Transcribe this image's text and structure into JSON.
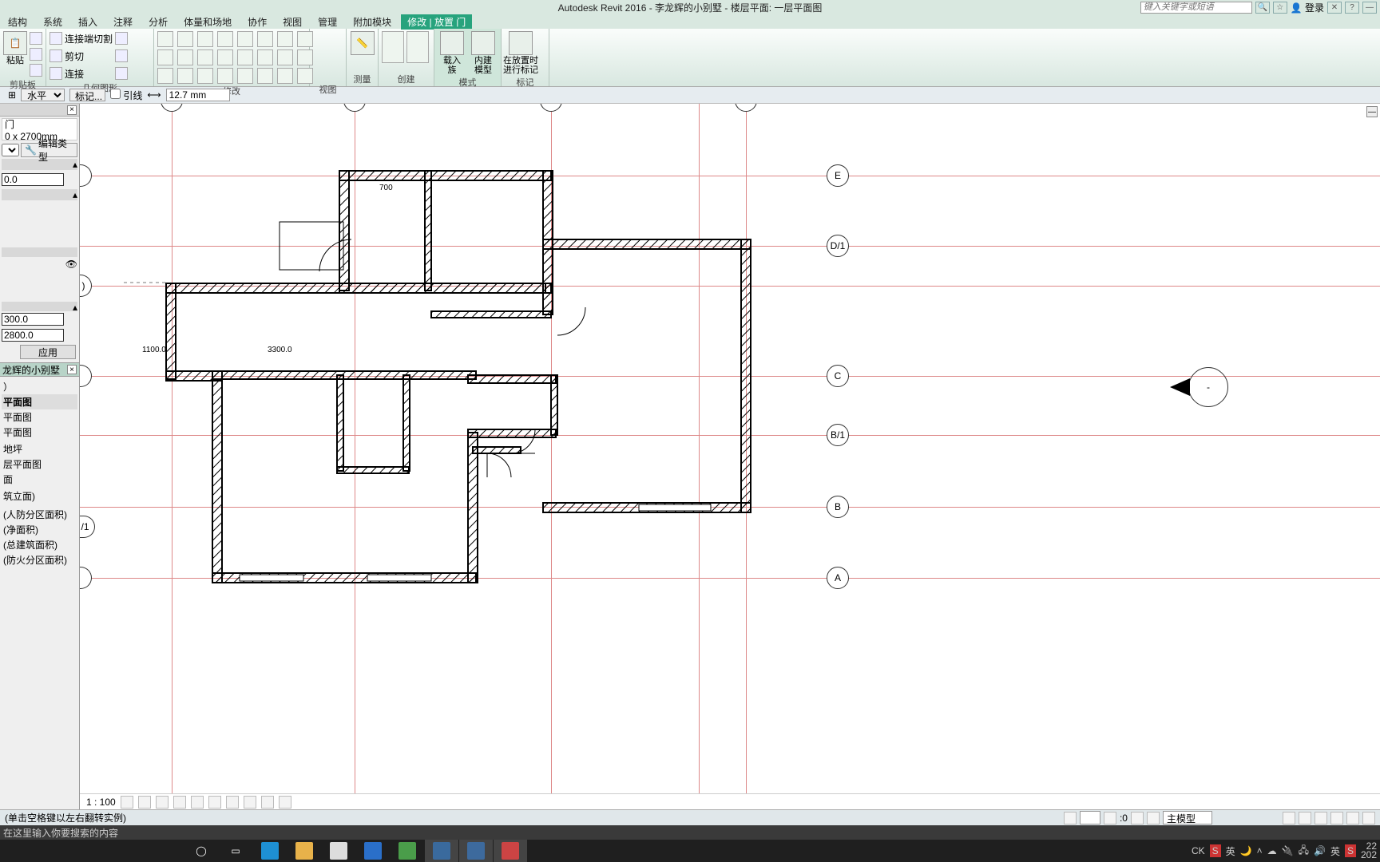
{
  "title": "Autodesk Revit 2016 -     李龙辉的小别墅 - 楼层平面: 一层平面图",
  "search_placeholder": "键入关键字或短语",
  "login_label": "登录",
  "menu": [
    "结构",
    "系统",
    "插入",
    "注释",
    "分析",
    "体量和场地",
    "协作",
    "视图",
    "管理",
    "附加模块",
    "修改 | 放置 门"
  ],
  "menu_active_index": 10,
  "ribbon_groups": {
    "clipboard": {
      "label": "剪贴板",
      "paste": "粘贴"
    },
    "geom": {
      "label": "几何图形",
      "items": [
        "连接端切割",
        "剪切",
        "连接"
      ]
    },
    "modify": {
      "label": "修改"
    },
    "view": {
      "label": "视图"
    },
    "measure": {
      "label": "测量"
    },
    "create": {
      "label": "创建"
    },
    "mode": {
      "label": "模式",
      "load": "载入\n族",
      "inplace": "内建\n模型"
    },
    "tag": {
      "label": "标记",
      "place": "在放置时\n进行标记"
    }
  },
  "options": {
    "orient": "水平",
    "tag_label": "标记...",
    "leader": "引线",
    "offset": "12.7 mm"
  },
  "properties": {
    "type_line1": "门",
    "type_line2": "0 x 2700mm",
    "edit_type": "编辑类型",
    "val_level": "0.0",
    "val_a": "300.0",
    "val_b": "2800.0",
    "apply": "应用"
  },
  "browser": {
    "title": "龙辉的小别墅",
    "items": [
      "）",
      "平面图",
      "平面图",
      "平面图",
      "",
      "地坪",
      "层平面图",
      "面",
      "",
      "筑立面)",
      "",
      "",
      "(人防分区面积)",
      "(净面积)",
      "(总建筑面积)",
      "(防火分区面积)"
    ],
    "sel_index": 1
  },
  "canvas": {
    "grid_x": [
      215,
      444,
      690,
      934
    ],
    "grid_y": {
      "E": 90,
      "D1": 178,
      "D": 228,
      "C": 341,
      "B1": 415,
      "B": 505,
      "A": 594
    },
    "grid_bub_left": {
      "D": 228,
      "1": 530,
      "A_bot": 594
    },
    "grid_labels": [
      "E",
      "D/1",
      "C",
      "B/1",
      "B",
      "A"
    ],
    "dims": {
      "d700": "700",
      "d1100": "1100.0",
      "d3300": "3300.0"
    },
    "north": "-",
    "scale": "1 : 100"
  },
  "status": {
    "hint": "(单击空格键以左右翻转实例)",
    "zero": ":0",
    "model": "主模型"
  },
  "search_row": "在这里输入你要搜索的内容",
  "tray": {
    "ime": "CK",
    "ime2": "英",
    "moon": "",
    "net": "",
    "spk": "",
    "more": "英",
    "time": "22",
    "date": "202"
  }
}
